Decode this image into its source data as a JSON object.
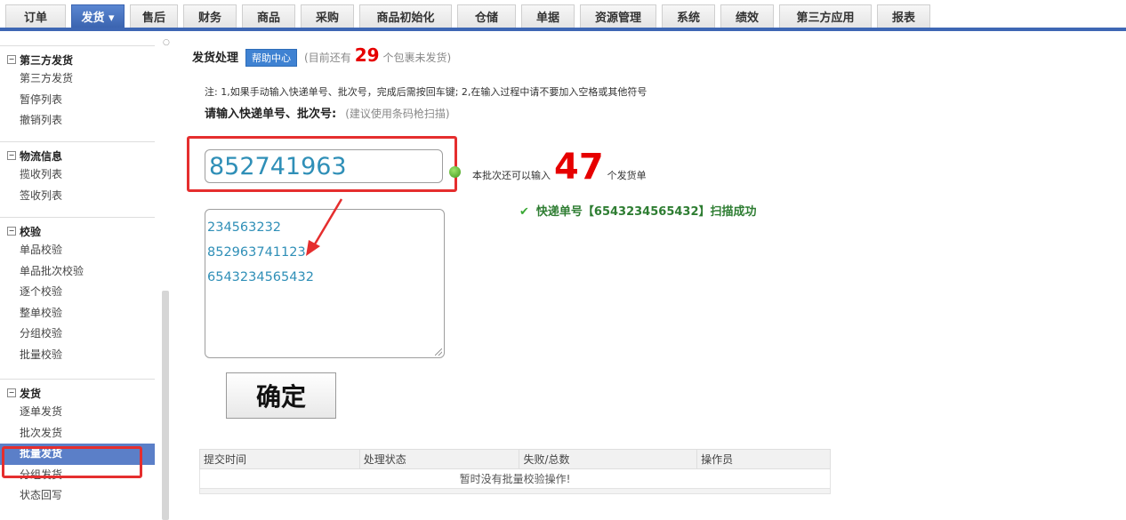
{
  "topnav": {
    "tabs": [
      "订单",
      "发货 ▾",
      "售后",
      "财务",
      "商品",
      "采购",
      "商品初始化",
      "仓储",
      "单据",
      "资源管理",
      "系统",
      "绩效",
      "第三方应用",
      "报表"
    ],
    "active_index": 1
  },
  "sidebar": {
    "groups": [
      {
        "title": "第三方发货",
        "items": [
          "第三方发货",
          "暂停列表",
          "撤销列表"
        ]
      },
      {
        "title": "物流信息",
        "items": [
          "揽收列表",
          "签收列表"
        ]
      },
      {
        "title": "校验",
        "items": [
          "单品校验",
          "单品批次校验",
          "逐个校验",
          "整单校验",
          "分组校验",
          "批量校验"
        ]
      },
      {
        "title": "发货",
        "items": [
          "逐单发货",
          "批次发货",
          "批量发货",
          "分组发货",
          "状态回写"
        ]
      }
    ],
    "active_item": "批量发货"
  },
  "main": {
    "title": "发货处理",
    "help_label": "帮助中心",
    "pending_prefix": "(目前还有",
    "pending_count": "29",
    "pending_suffix": "个包裹未发货)",
    "note": "注: 1,如果手动输入快递单号、批次号，完成后需按回车键; 2,在输入过程中请不要加入空格或其他符号",
    "prompt_label": "请输入快递单号、批次号:",
    "prompt_hint": "(建议使用条码枪扫描)",
    "scan_value": "852741963",
    "remain_prefix": "本批次还可以输入",
    "remain_count": "47",
    "remain_suffix": "个发货单",
    "success_msg": "快递单号【6543234565432】扫描成功",
    "entered": [
      "234563232",
      "852963741123",
      "6543234565432"
    ],
    "confirm_label": "确定",
    "table": {
      "headers": [
        "提交时间",
        "处理状态",
        "失败/总数",
        "操作员"
      ],
      "empty_msg": "暂时没有批量校验操作!"
    }
  },
  "colors": {
    "accent": "#3e67b4",
    "highlight_red": "#e52e2e",
    "number_red": "#e60000",
    "success_green": "#2e7d32"
  }
}
